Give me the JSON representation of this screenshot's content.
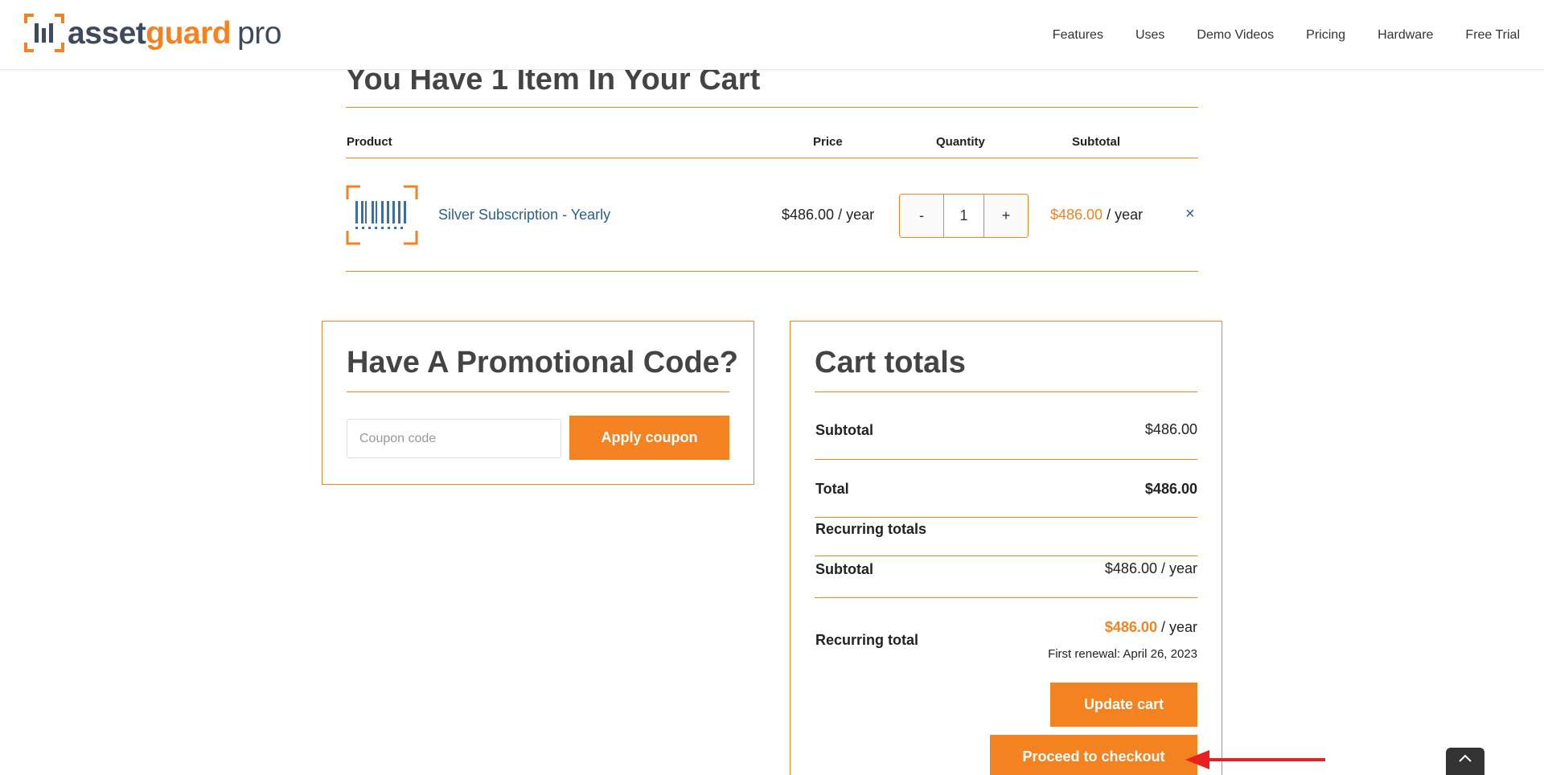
{
  "brand": {
    "part1": "asset",
    "part2": "guard",
    "part3": "pro"
  },
  "nav": [
    "Features",
    "Uses",
    "Demo Videos",
    "Pricing",
    "Hardware",
    "Free Trial"
  ],
  "cart": {
    "title": "You Have 1 Item In Your Cart",
    "headers": {
      "product": "Product",
      "price": "Price",
      "quantity": "Quantity",
      "subtotal": "Subtotal"
    },
    "item": {
      "name": "Silver Subscription - Yearly",
      "price": "$486.00 / year",
      "qty_minus": "-",
      "qty_value": "1",
      "qty_plus": "+",
      "subtotal_amount": "$486.00",
      "subtotal_period": " / year",
      "remove": "×"
    }
  },
  "promo": {
    "title": "Have A Promotional Code?",
    "placeholder": "Coupon code",
    "apply_label": "Apply coupon"
  },
  "totals": {
    "title": "Cart totals",
    "subtotal_label": "Subtotal",
    "subtotal_value": "$486.00",
    "total_label": "Total",
    "total_value": "$486.00",
    "recurring_label": "Recurring totals",
    "rec_subtotal_label": "Subtotal",
    "rec_subtotal_value": "$486.00 / year",
    "rec_total_label": "Recurring total",
    "rec_total_amount": "$486.00",
    "rec_total_period": " / year",
    "renewal": "First renewal: April 26, 2023",
    "update_label": "Update cart",
    "checkout_label": "Proceed to checkout"
  },
  "colors": {
    "accent": "#f58220",
    "link": "#2c5f8f",
    "annotation_arrow": "#e8201f"
  }
}
